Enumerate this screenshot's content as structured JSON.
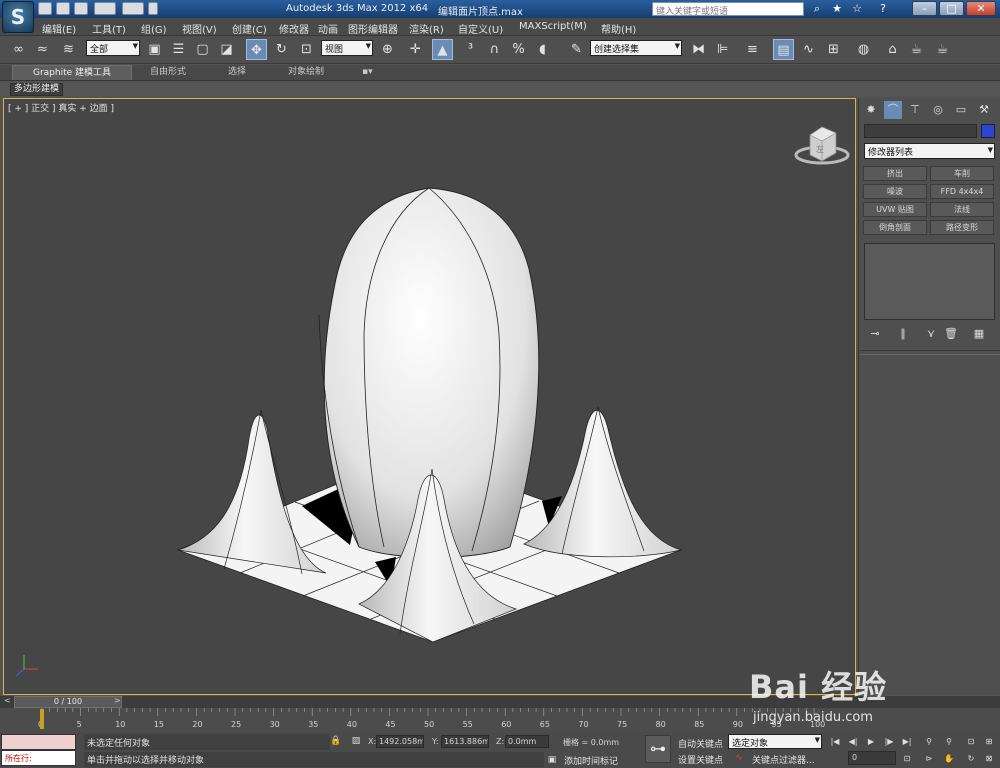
{
  "titlebar": {
    "app_title": "Autodesk 3ds Max  2012 x64",
    "file_name": "编辑面片顶点.max",
    "help_search_placeholder": "键入关键字或短语",
    "logo_glyph": "S"
  },
  "menu": [
    "编辑(E)",
    "工具(T)",
    "组(G)",
    "视图(V)",
    "创建(C)",
    "修改器",
    "动画",
    "图形编辑器",
    "渲染(R)",
    "自定义(U)",
    "MAXScript(M)",
    "帮助(H)"
  ],
  "toolbar": {
    "selection_filter": "全部",
    "ref_coord": "视图",
    "named_selection": "创建选择集"
  },
  "ribbon": {
    "tabs": [
      "Graphite 建模工具",
      "自由形式",
      "选择",
      "对象绘制"
    ],
    "subtab": "多边形建模"
  },
  "viewport": {
    "label": "[ + ] 正交 ] 真实 + 边面 ]",
    "border_color": "#d9b34a",
    "viewcube_label": "左"
  },
  "command_panel": {
    "object_color": "#2d45d6",
    "modifier_list": "修改器列表",
    "modifier_buttons": [
      "挤出",
      "车削",
      "噪波",
      "FFD 4x4x4",
      "UVW 贴图",
      "法线",
      "倒角剖面",
      "路径变形"
    ]
  },
  "timeline": {
    "frame_display": "0 / 100",
    "ticks": [
      0,
      5,
      10,
      15,
      20,
      25,
      30,
      35,
      40,
      45,
      50,
      55,
      60,
      65,
      70,
      75,
      80,
      85,
      90,
      95,
      100
    ]
  },
  "status": {
    "running_label": "所在行:",
    "selection_status": "未选定任何对象",
    "prompt": "单击并拖动以选择并移动对象",
    "x_label": "X:",
    "x_value": "1492.058m",
    "y_label": "Y:",
    "y_value": "1613.886m",
    "z_label": "Z:",
    "z_value": "0.0mm",
    "grid": "栅格 = 0.0mm",
    "add_time_tag": "添加时间标记",
    "auto_key": "自动关键点",
    "set_key": "设置关键点",
    "selected_object": "选定对象",
    "key_filters": "关键点过滤器...",
    "current_frame": "0"
  },
  "watermark": {
    "brand": "Bai 经验",
    "url": "jingyan.baidu.com"
  }
}
